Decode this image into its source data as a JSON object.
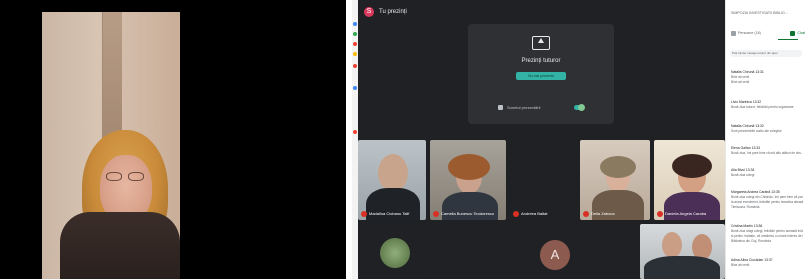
{
  "meeting": {
    "presenter_badge": "S",
    "presenting_label": "Tu prezinți",
    "present_card": {
      "title": "Prezinți tuturor",
      "stop_label": "Nu mai prezenta",
      "audio_label": "Sunetul prezentării"
    },
    "tiles": [
      {
        "name": "Madalina Ciobanu Talif",
        "initial": ""
      },
      {
        "name": "Camelia Bunescu Teodorescu",
        "initial": ""
      },
      {
        "name": "Andreea Baltat",
        "initial": ""
      },
      {
        "name": "Delia Zaboca",
        "initial": ""
      },
      {
        "name": "Daniela Angela Caraba",
        "initial": ""
      },
      {
        "name": "",
        "initial": ""
      },
      {
        "name": "",
        "initial": "A"
      },
      {
        "name": "",
        "initial": ""
      }
    ]
  },
  "chat": {
    "title": "SIMPOZIA INVESTIGATII BIBLIO...",
    "tab_people": "Persoane (18)",
    "tab_chat": "Chat",
    "note": "Poți trimite mesaje tuturor din apel",
    "messages": [
      {
        "author": "Natalia Chirună",
        "time": "13:31",
        "lines": [
          "Bine ați venit",
          "Bine ați venit"
        ]
      },
      {
        "author": "Liviu Marinica",
        "time": "13:32",
        "lines": [
          "Bună ziua tuturor, felicitări pentru organizare"
        ]
      },
      {
        "author": "Natalia Chirună",
        "time": "13:32",
        "lines": [
          "Sunt prezentările audio ale colegilor"
        ]
      },
      {
        "author": "Elena Gaifan",
        "time": "13:33",
        "lines": [
          "Bună ziua, îmi pare bine că mă aflu alături de dvs."
        ]
      },
      {
        "author": "Alla Bivol",
        "time": "13:34",
        "lines": [
          "Bună ziua colegi"
        ]
      },
      {
        "author": "Margareta Andrea Carabă",
        "time": "13:35",
        "lines": [
          "Bună ziua colegi din Chișinău, îmi pare bine că particip",
          "la acest eveniment, felicitări pentru tematica aleasă",
          "Timișoara, România"
        ]
      },
      {
        "author": "Cristina Martin",
        "time": "13:36",
        "lines": [
          "Bună ziua dragi colegi, felicitări pentru această inițiativă",
          "și pentru invitație, vă urmăresc cu mare interes de la",
          "Biblioteca din Cluj, România"
        ]
      },
      {
        "author": "Adina Alina Ciocârlan",
        "time": "13:37",
        "lines": [
          "Bine ați venit"
        ]
      }
    ]
  },
  "colors": {
    "meeting_bg": "#202124",
    "card_bg": "#2f3033",
    "accent": "#33b3a6",
    "presenter_badge": "#d93a5d",
    "chat_active": "#137333"
  }
}
